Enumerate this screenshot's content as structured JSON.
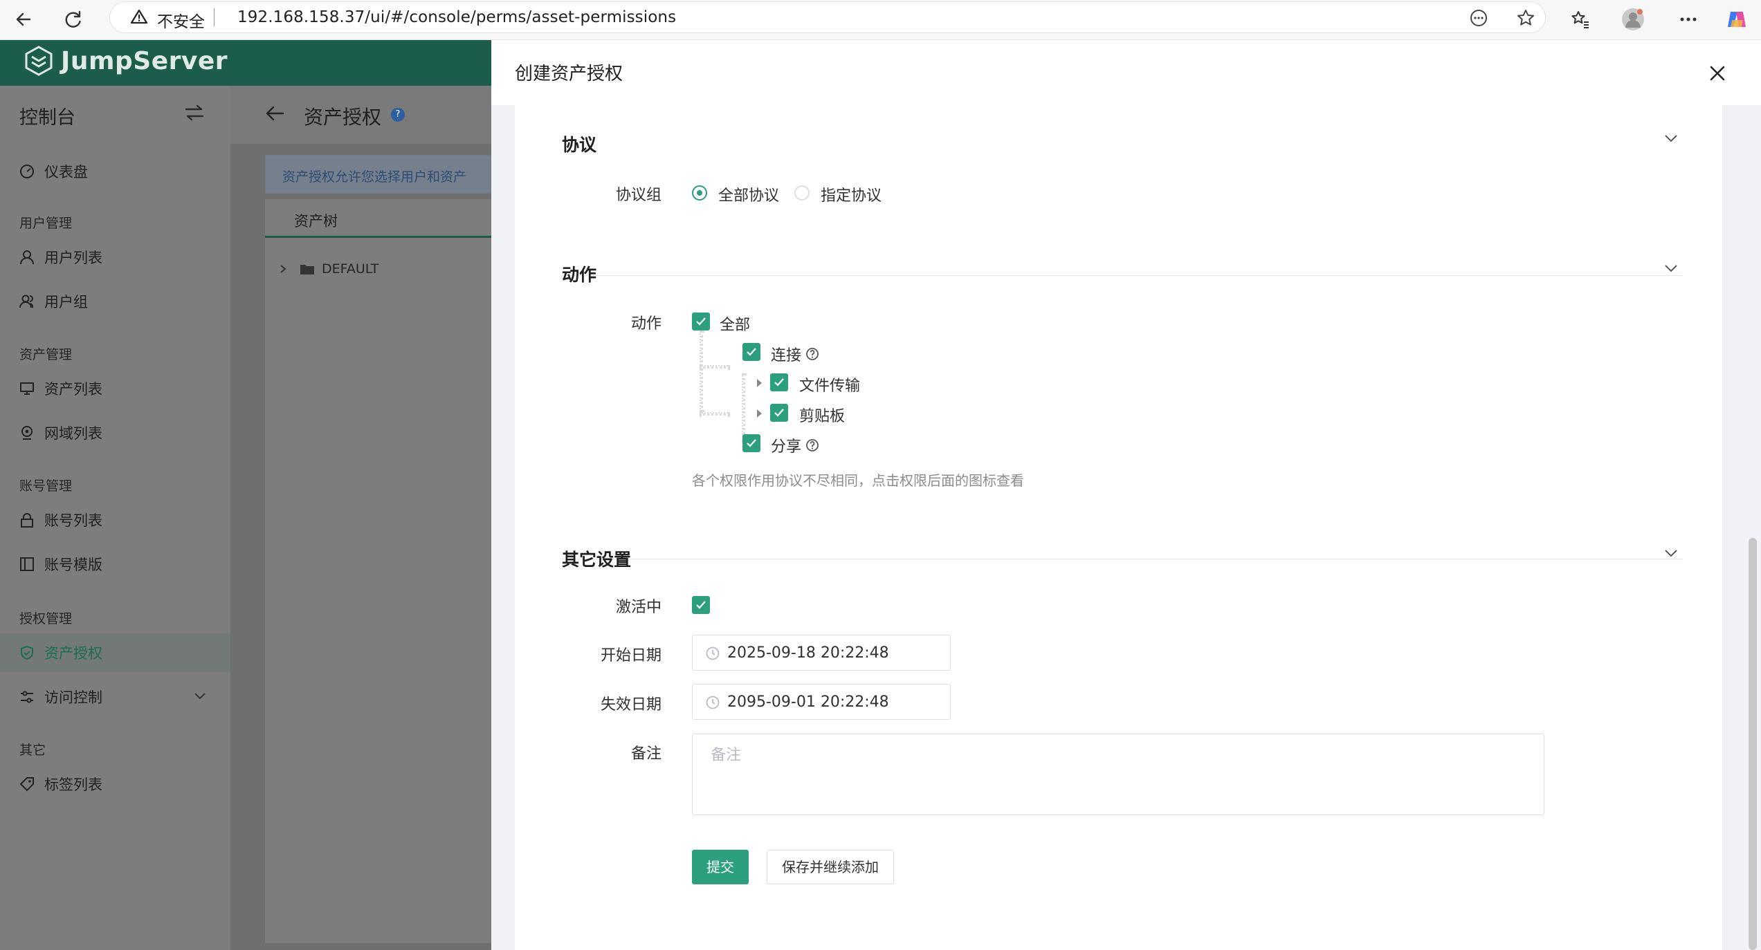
{
  "browser": {
    "insecure_label": "不安全",
    "url": "192.168.158.37/ui/#/console/perms/asset-permissions"
  },
  "app": {
    "logo_text": "JumpServer"
  },
  "sidebar": {
    "title": "控制台",
    "dashboard": "仪表盘",
    "groups": {
      "user_mgmt": "用户管理",
      "asset_mgmt": "资产管理",
      "account_mgmt": "账号管理",
      "perm_mgmt": "授权管理",
      "other": "其它"
    },
    "items": {
      "user_list": "用户列表",
      "user_group": "用户组",
      "asset_list": "资产列表",
      "zone_list": "网域列表",
      "account_list": "账号列表",
      "account_template": "账号模版",
      "asset_perm": "资产授权",
      "access_control": "访问控制",
      "tag_list": "标签列表"
    }
  },
  "page": {
    "title": "资产授权",
    "help_icon": "?",
    "info": "资产授权允许您选择用户和资产",
    "tree_tab": "资产树",
    "tree_node": "DEFAULT"
  },
  "drawer": {
    "title": "创建资产授权",
    "protocol": {
      "section_title": "协议",
      "group_label": "协议组",
      "option_all": "全部协议",
      "option_specified": "指定协议"
    },
    "actions": {
      "section_title": "动作",
      "field_label": "动作",
      "all": "全部",
      "connect": "连接",
      "file_transfer": "文件传输",
      "clipboard": "剪贴板",
      "share": "分享",
      "hint": "各个权限作用协议不尽相同，点击权限后面的图标查看"
    },
    "other": {
      "section_title": "其它设置",
      "active_label": "激活中",
      "start_label": "开始日期",
      "start_value": "2025-09-18 20:22:48",
      "end_label": "失效日期",
      "end_value": "2095-09-01 20:22:48",
      "comment_label": "备注",
      "comment_placeholder": "备注"
    },
    "buttons": {
      "submit": "提交",
      "save_continue": "保存并继续添加"
    }
  },
  "colors": {
    "brand": "#1b5c4a",
    "accent": "#2c9f7f"
  }
}
